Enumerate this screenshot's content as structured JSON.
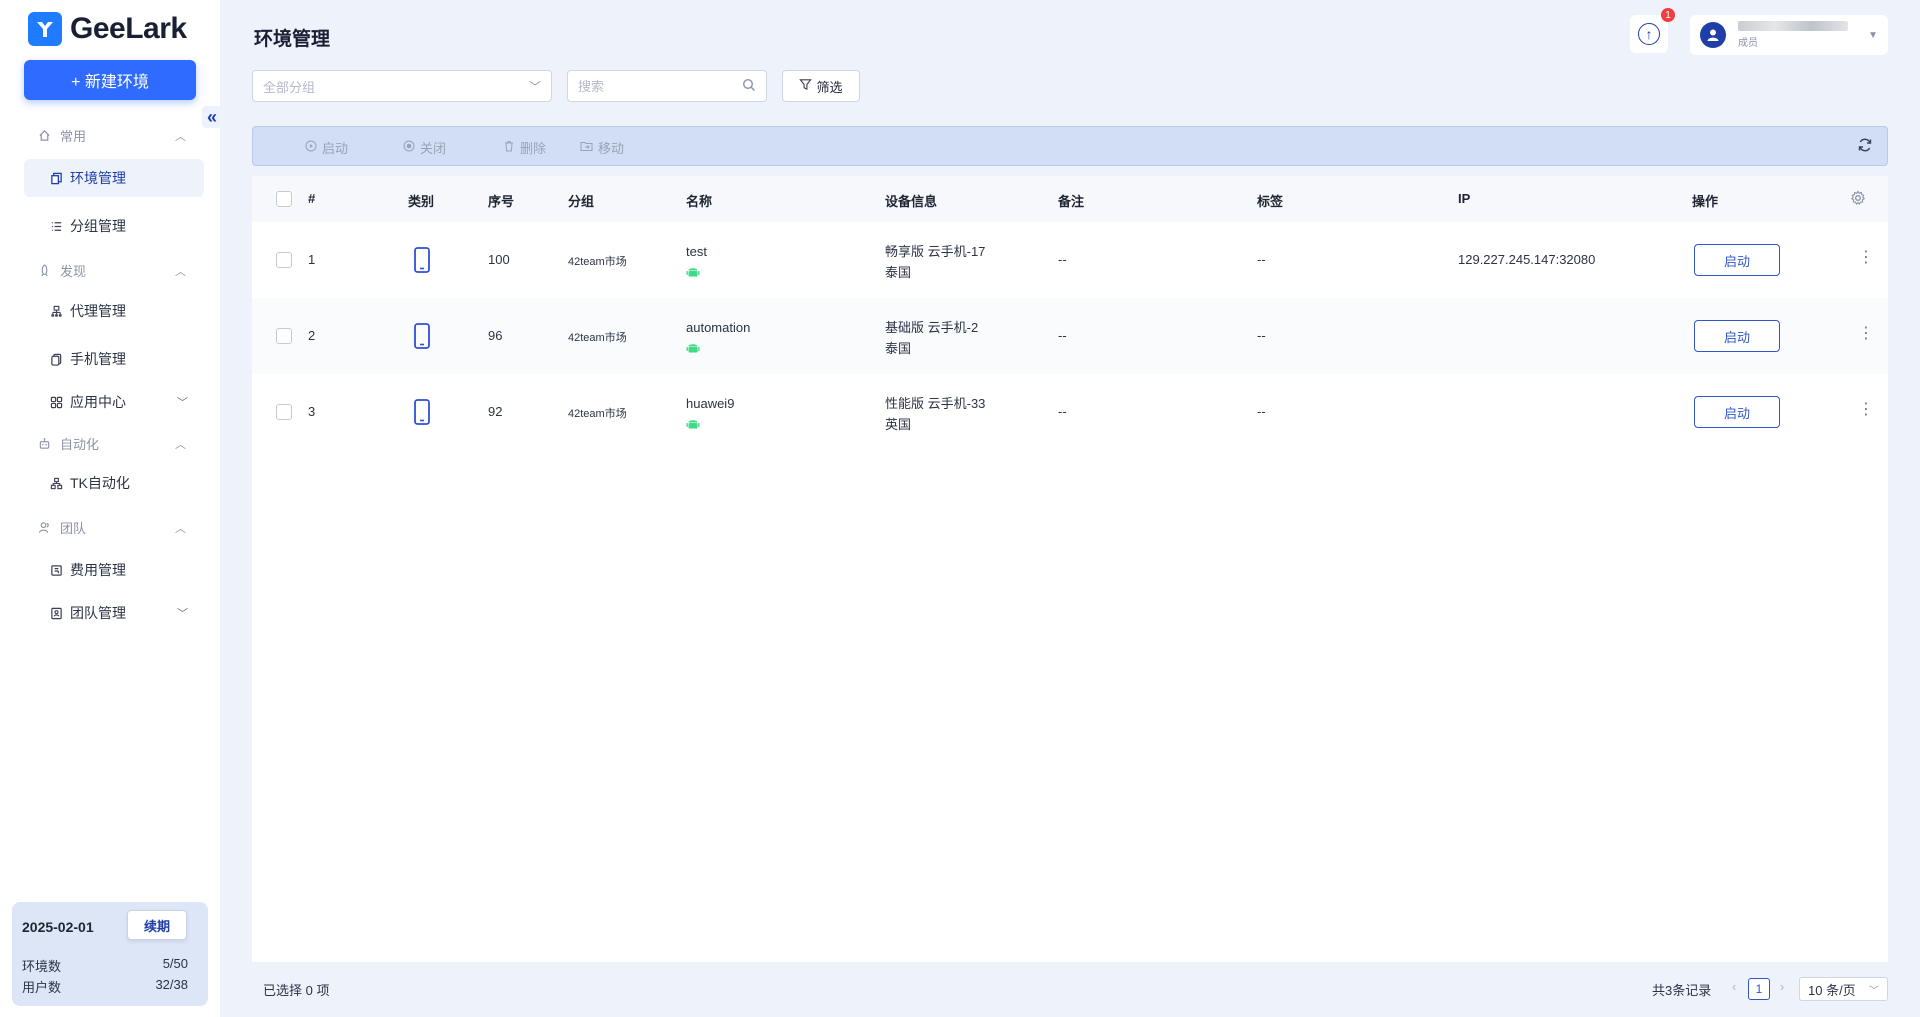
{
  "app": {
    "brand": "GeeLark",
    "new_env_label": "+ 新建环境"
  },
  "sidebar": {
    "groups": [
      {
        "label": "常用",
        "icon": "home-icon"
      },
      {
        "label": "发现",
        "icon": "rocket-icon"
      },
      {
        "label": "自动化",
        "icon": "robot-icon"
      },
      {
        "label": "团队",
        "icon": "team-icon"
      }
    ],
    "items": [
      {
        "label": "环境管理",
        "icon": "env-icon",
        "active": true
      },
      {
        "label": "分组管理",
        "icon": "list-icon"
      },
      {
        "label": "代理管理",
        "icon": "proxy-icon"
      },
      {
        "label": "手机管理",
        "icon": "phone-stack-icon"
      },
      {
        "label": "应用中心",
        "icon": "apps-icon"
      },
      {
        "label": "TK自动化",
        "icon": "flow-icon"
      },
      {
        "label": "费用管理",
        "icon": "bill-icon"
      },
      {
        "label": "团队管理",
        "icon": "team-manage-icon"
      }
    ]
  },
  "plan": {
    "date": "2025-02-01",
    "renew_label": "续期",
    "env_count_label": "环境数",
    "env_count_value": "5/50",
    "user_count_label": "用户数",
    "user_count_value": "32/38"
  },
  "header": {
    "title": "环境管理",
    "notification_count": "1",
    "user_role": "成员"
  },
  "filters": {
    "group_placeholder": "全部分组",
    "search_placeholder": "搜索",
    "filter_label": "筛选"
  },
  "toolbar": {
    "start_label": "启动",
    "close_label": "关闭",
    "delete_label": "删除",
    "move_label": "移动"
  },
  "table": {
    "columns": [
      "#",
      "类别",
      "序号",
      "分组",
      "名称",
      "设备信息",
      "备注",
      "标签",
      "IP",
      "操作"
    ],
    "rows": [
      {
        "index": "1",
        "serial": "100",
        "group": "42team市场",
        "name": "test",
        "device_line1": "畅享版 云手机-17",
        "device_line2": "泰国",
        "remark": "--",
        "tags": "--",
        "ip": "129.227.245.147:32080",
        "action": "启动"
      },
      {
        "index": "2",
        "serial": "96",
        "group": "42team市场",
        "name": "automation",
        "device_line1": "基础版 云手机-2",
        "device_line2": "泰国",
        "remark": "--",
        "tags": "--",
        "ip": "",
        "action": "启动"
      },
      {
        "index": "3",
        "serial": "92",
        "group": "42team市场",
        "name": "huawei9",
        "device_line1": "性能版 云手机-33",
        "device_line2": "英国",
        "remark": "--",
        "tags": "--",
        "ip": "",
        "action": "启动"
      }
    ]
  },
  "footer": {
    "selected_text": "已选择 0 项",
    "total_text": "共3条记录",
    "current_page": "1",
    "page_size": "10 条/页"
  },
  "colors": {
    "primary": "#2f6bff",
    "accent": "#1f3ea8",
    "android": "#3ddc84",
    "badge": "#f03e3e"
  }
}
